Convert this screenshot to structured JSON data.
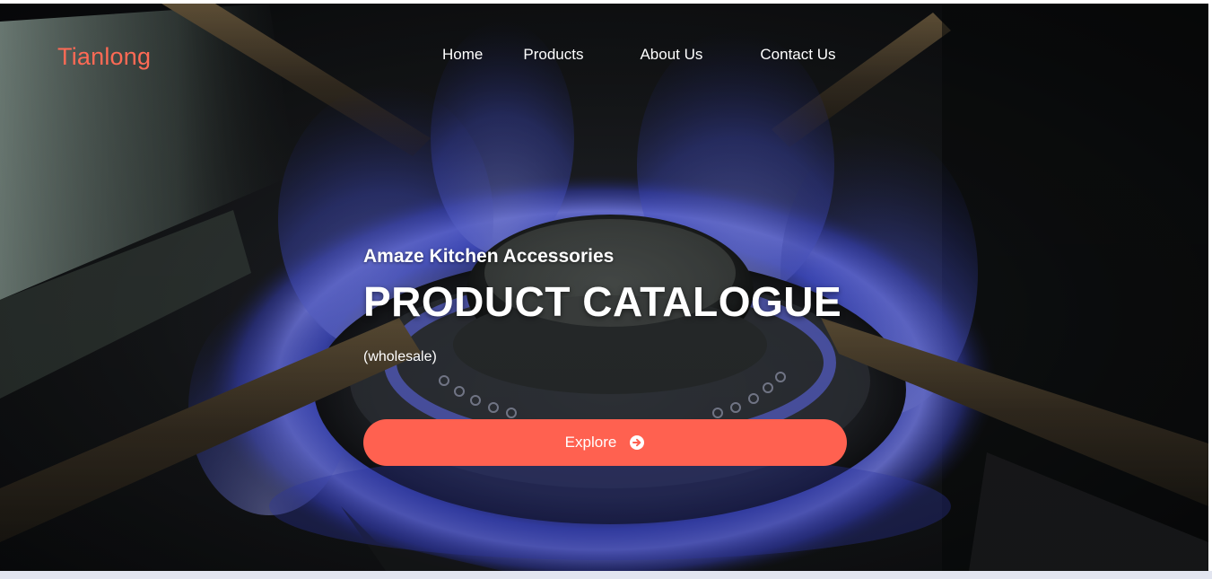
{
  "nav": {
    "logo": "Tianlong",
    "items": [
      {
        "label": "Home"
      },
      {
        "label": "Products"
      },
      {
        "label": "About Us"
      },
      {
        "label": "Contact Us"
      }
    ]
  },
  "hero": {
    "subtitle": "Amaze Kitchen Accessories",
    "title": "PRODUCT CATALOGUE",
    "note": "(wholesale)",
    "cta_label": "Explore",
    "cta_icon": "arrow-right-circle-icon",
    "background": "gas stove burner with blue flame"
  },
  "colors": {
    "accent": "#ff6150",
    "logo": "#ff6a55",
    "text": "#ffffff",
    "flame": "#4a5cff"
  }
}
